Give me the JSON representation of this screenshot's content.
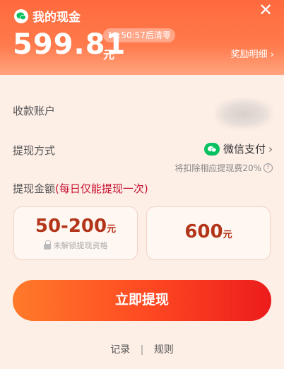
{
  "header": {
    "title": "我的现金",
    "amount": "599.81",
    "amount_unit": "元",
    "timer": "12:50:57后清零",
    "reward_link": "奖励明细 ›",
    "close": "✕"
  },
  "form": {
    "account_label": "收款账户",
    "method_label": "提现方式",
    "method_value": "微信支付",
    "method_chevron": "›",
    "fee_note": "将扣除相应提现费20%",
    "fee_help": "?",
    "amount_label": "提现金额",
    "amount_label_highlight": "(每日仅能提现一次)"
  },
  "options": [
    {
      "value": "50-200",
      "unit": "元",
      "lock_text": "未解锁提现资格"
    },
    {
      "value": "600",
      "unit": "元"
    }
  ],
  "button": {
    "withdraw": "立即提现"
  },
  "footer": {
    "records": "记录",
    "separator": "|",
    "rules": "规则"
  },
  "colors": {
    "header_start": "#ff6a3d",
    "accent_red": "#c8102e",
    "option_value": "#b3361a",
    "wechat_green": "#07c160"
  },
  "icons": {
    "title_icon": "wechat-icon",
    "close": "close-icon",
    "pay": "wechat-pay-icon",
    "lock": "lock-icon"
  }
}
